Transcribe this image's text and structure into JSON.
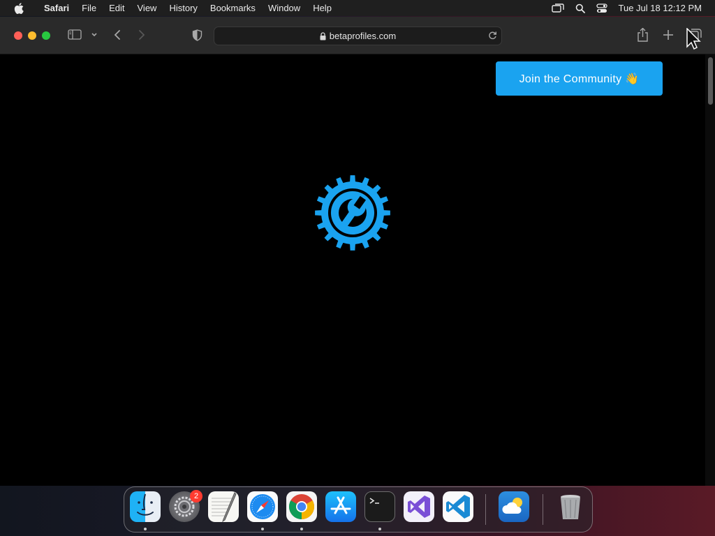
{
  "menubar": {
    "app_name": "Safari",
    "items": [
      "File",
      "Edit",
      "View",
      "History",
      "Bookmarks",
      "Window",
      "Help"
    ],
    "clock": "Tue Jul 18  12:12 PM"
  },
  "browser": {
    "url": "betaprofiles.com"
  },
  "page": {
    "join_button": "Join the Community 👋",
    "accent_color": "#1aa3f0",
    "loading_icon": "gear-wrench-icon"
  },
  "dock": {
    "apps": [
      "Finder",
      "System Settings",
      "TextEdit",
      "Safari",
      "Google Chrome",
      "App Store",
      "Terminal",
      "Visual Studio",
      "Visual Studio Code",
      "Weather",
      "Trash"
    ],
    "settings_badge": "2"
  }
}
